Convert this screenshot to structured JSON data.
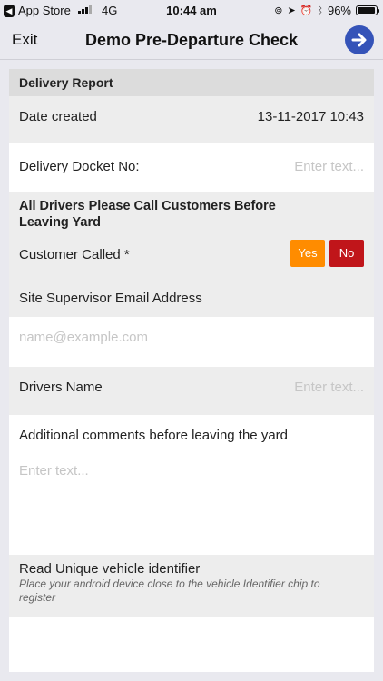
{
  "status_bar": {
    "back_app": "App Store",
    "network": "4G",
    "time": "10:44 am",
    "battery_percent": "96%",
    "battery_level": 0.96
  },
  "nav": {
    "exit_label": "Exit",
    "title": "Demo Pre-Departure Check",
    "next_icon": "arrow-right-icon"
  },
  "form": {
    "delivery_report": {
      "section_title": "Delivery Report",
      "date_created_label": "Date created",
      "date_created_value": "13-11-2017 10:43",
      "docket_label": "Delivery Docket No:",
      "docket_placeholder": "Enter text..."
    },
    "call_section": {
      "title": "All Drivers Please Call Customers Before Leaving Yard",
      "customer_called_label": "Customer Called *",
      "yes_label": "Yes",
      "no_label": "No",
      "yes_color": "#ff8c00",
      "no_color": "#c0151a"
    },
    "supervisor": {
      "label": "Site Supervisor Email Address",
      "placeholder": "name@example.com"
    },
    "drivers": {
      "label": "Drivers Name",
      "placeholder": "Enter text..."
    },
    "comments": {
      "label": "Additional comments before leaving the yard",
      "placeholder": "Enter text..."
    },
    "vehicle": {
      "label": "Read Unique vehicle identifier",
      "hint": "Place your android device close to the vehicle Identifier chip to register"
    }
  }
}
